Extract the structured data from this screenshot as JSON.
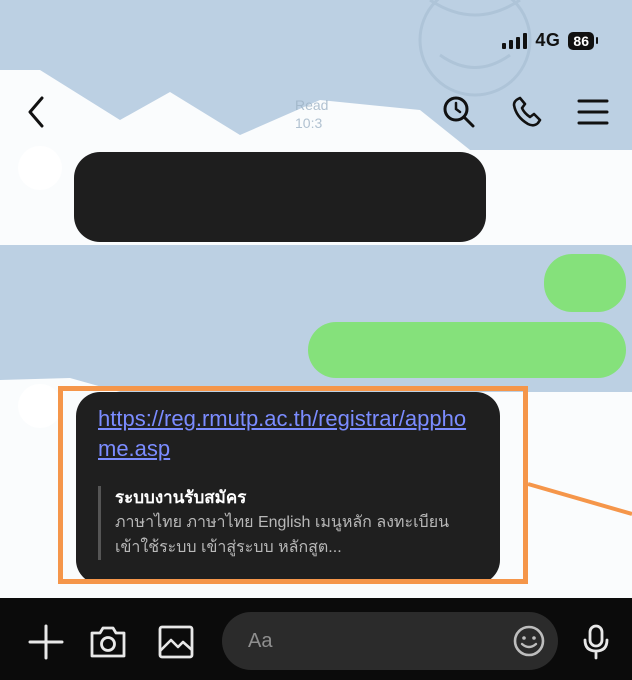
{
  "status_bar": {
    "network": "4G",
    "battery": "86"
  },
  "header": {
    "back_icon": "chevron-left-icon",
    "search_icon": "search-icon",
    "call_icon": "phone-icon",
    "menu_icon": "hamburger-menu-icon"
  },
  "background_ghost": {
    "line1": "Read",
    "line2": "10:3"
  },
  "link_message": {
    "url": "https://reg.rmutp.ac.th/registrar/apphome.asp",
    "preview_title": "ระบบงานรับสมัคร",
    "preview_description": "ภาษาไทย ภาษาไทย English เมนูหลัก ลงทะเบียน เข้าใช้ระบบ เข้าสู่ระบบ หลักสูต..."
  },
  "composer": {
    "placeholder": "Aa",
    "icons": [
      "plus-icon",
      "camera-icon",
      "image-icon",
      "emoji-icon",
      "microphone-icon"
    ]
  },
  "colors": {
    "background": "#bcd0e3",
    "incoming_bubble": "#1e1e1e",
    "outgoing_bubble": "#85e17b",
    "highlight": "#f5964a",
    "link": "#7b8cff"
  }
}
